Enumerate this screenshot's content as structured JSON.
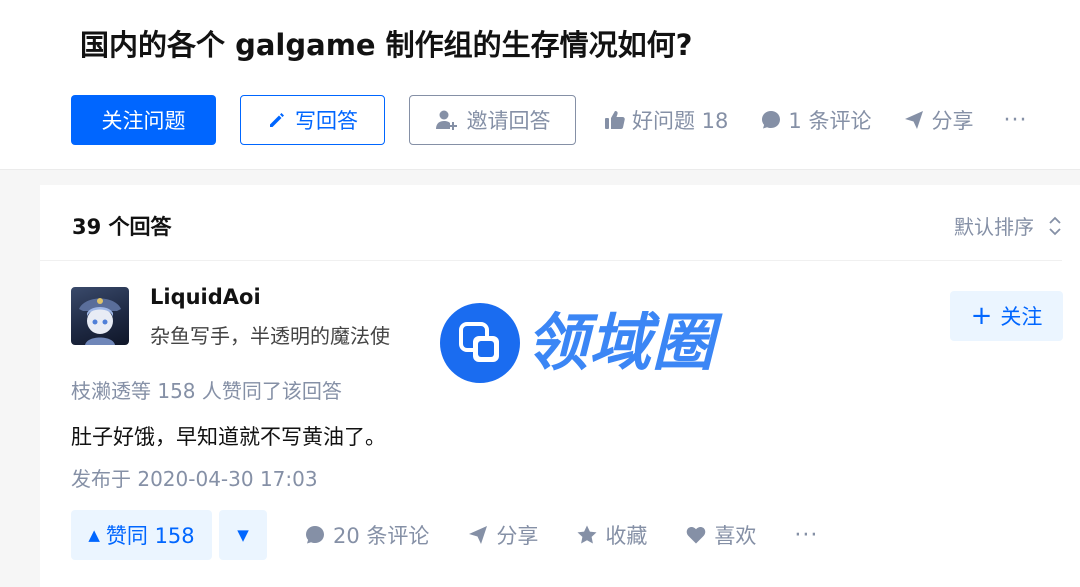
{
  "question": {
    "title": "国内的各个 galgame 制作组的生存情况如何?",
    "follow_label": "关注问题",
    "write_label": "写回答",
    "invite_label": "邀请回答",
    "good_question_label": "好问题 18",
    "comments_label": "1 条评论",
    "share_label": "分享",
    "more_label": "···"
  },
  "answers": {
    "count_label": "39 个回答",
    "sort_label": "默认排序"
  },
  "answer": {
    "author_name": "LiquidAoi",
    "author_bio": "杂鱼写手，半透明的魔法使",
    "follow_label": "关注",
    "upvote_info": "枝濑透等 158 人赞同了该回答",
    "content": "肚子好饿，早知道就不写黄油了。",
    "date": "发布于 2020-04-30 17:03",
    "vote_up_label": "赞同 158",
    "vote_up_symbol": "▲",
    "vote_down_symbol": "▼",
    "comments_label": "20 条评论",
    "share_label": "分享",
    "collect_label": "收藏",
    "like_label": "喜欢",
    "more_label": "···"
  },
  "watermark": {
    "text": "领域圈"
  },
  "colors": {
    "brand_blue": "#0066ff",
    "muted_gray": "#8590a6",
    "light_blue_bg": "#ebf5ff"
  }
}
